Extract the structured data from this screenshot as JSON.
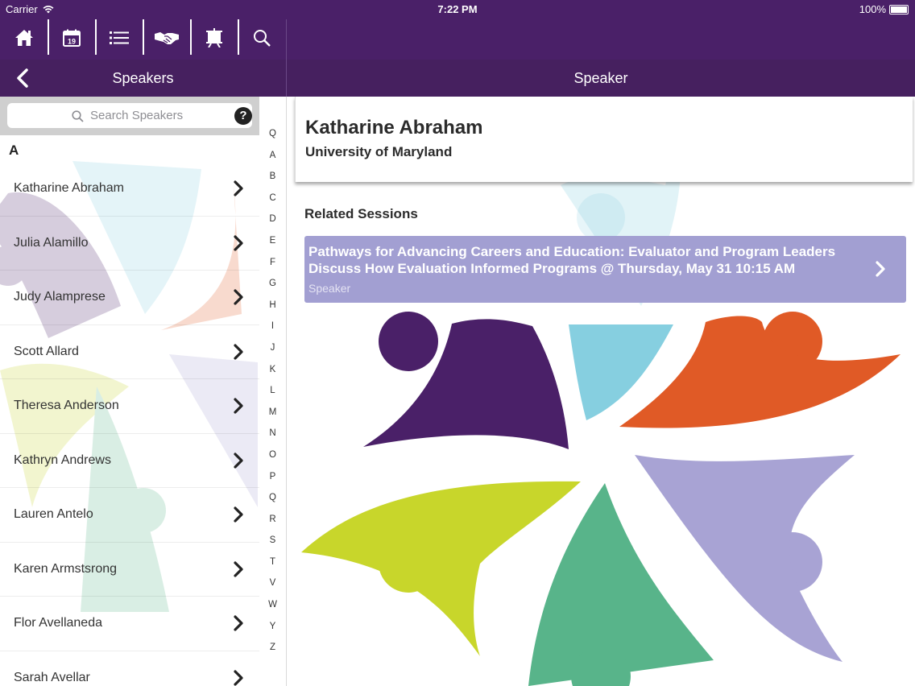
{
  "status_bar": {
    "carrier": "Carrier",
    "time": "7:22 PM",
    "battery": "100%"
  },
  "toolbar": {
    "icons": [
      "home-icon",
      "calendar-icon",
      "list-icon",
      "handshake-icon",
      "presentation-icon",
      "search-icon"
    ],
    "calendar_day": "19"
  },
  "left_header": {
    "title": "Speakers"
  },
  "right_header": {
    "title": "Speaker"
  },
  "search": {
    "placeholder": "Search Speakers",
    "help": "?"
  },
  "section_letter": "A",
  "speakers": [
    "Katharine Abraham",
    "Julia Alamillo",
    "Judy Alamprese",
    "Scott Allard",
    "Theresa Anderson",
    "Kathryn Andrews",
    "Lauren Antelo",
    "Karen Armstsrong",
    "Flor Avellaneda",
    "Sarah Avellar"
  ],
  "index_letters": [
    "Q",
    "A",
    "B",
    "C",
    "D",
    "E",
    "F",
    "G",
    "H",
    "I",
    "J",
    "K",
    "L",
    "M",
    "N",
    "O",
    "P",
    "Q",
    "R",
    "S",
    "T",
    "V",
    "W",
    "Y",
    "Z"
  ],
  "speaker_detail": {
    "name": "Katharine Abraham",
    "organization": "University of Maryland",
    "related_heading": "Related Sessions",
    "session": {
      "title": "Pathways for Advancing Careers and Education: Evaluator and Program Leaders Discuss How Evaluation Informed Programs @ Thursday, May 31 10:15 AM",
      "role": "Speaker"
    }
  },
  "colors": {
    "header": "#4a2068",
    "session_bg": "#a29fd2",
    "purple": "#4a2068",
    "blue": "#86cfe0",
    "orange": "#e05a26",
    "green": "#c8d62b",
    "teal": "#58b48a",
    "lavender": "#a8a3d4"
  }
}
